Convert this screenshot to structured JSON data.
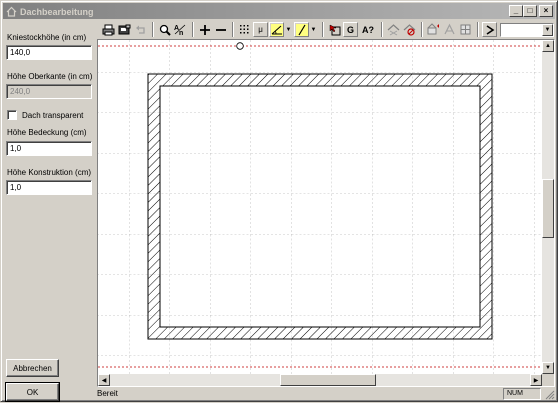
{
  "window": {
    "title": "Dachbearbeitung",
    "buttons": {
      "minimize": "_",
      "maximize": "□",
      "close": "×"
    }
  },
  "form": {
    "kniestock_label": "Kniestockhöhe (in cm)",
    "kniestock_value": "140,0",
    "oberkante_label": "Höhe Oberkante (in cm)",
    "oberkante_value": "240,0",
    "transparent_label": "Dach transparent",
    "transparent_checked": false,
    "bedeckung_label": "Höhe Bedeckung (cm)",
    "bedeckung_value": "1,0",
    "konstruktion_label": "Höhe Konstruktion (cm)",
    "konstruktion_value": "1,0"
  },
  "buttons": {
    "cancel": "Abbrechen",
    "ok": "OK"
  },
  "toolbar": {
    "tools": [
      "printer-icon",
      "print-preview-icon",
      "undo-icon",
      "zoom-icon",
      "zoom-range-icon",
      "plus-icon",
      "minus-icon",
      "grid-icon",
      "snap-icon",
      "angle-tool-icon",
      "line-tool-icon",
      "dropdown-arrow-icon",
      "select-icon",
      "text-g-icon",
      "text-query-icon",
      "roof-edit-icon",
      "roof-delete-icon",
      "roof-a-icon",
      "roof-b-icon",
      "roof-c-icon",
      "arrow-right-icon"
    ],
    "text_tool_label": "G",
    "query_tool_label": "A?",
    "snap_label": "μ",
    "combo_value": ""
  },
  "status": {
    "text": "Bereit",
    "num": "NUM"
  },
  "colors": {
    "titlebar": "#808080",
    "guide_line": "#c00000",
    "wall_hatch": "#000000",
    "grid": "#b8b8b8"
  }
}
